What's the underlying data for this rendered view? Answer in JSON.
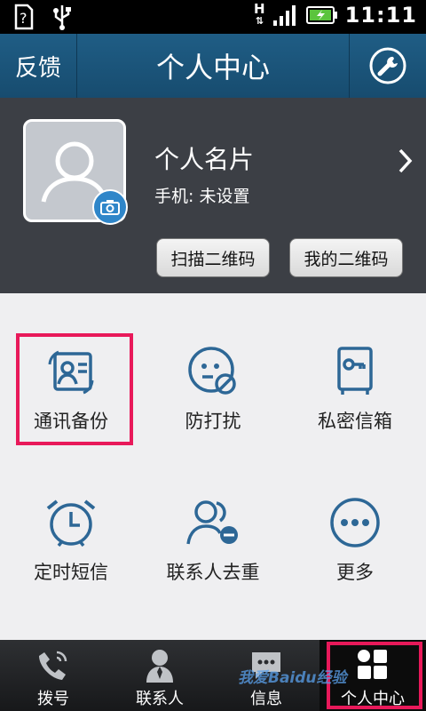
{
  "status_bar": {
    "time": "11:11",
    "network_label": "H"
  },
  "header": {
    "feedback_label": "反馈",
    "title": "个人中心",
    "settings_icon": "wrench-icon"
  },
  "profile": {
    "name": "个人名片",
    "phone": "手机: 未设置",
    "scan_qr_label": "扫描二维码",
    "my_qr_label": "我的二维码"
  },
  "features": [
    {
      "label": "通讯备份",
      "icon": "contact-backup-icon"
    },
    {
      "label": "防打扰",
      "icon": "do-not-disturb-icon"
    },
    {
      "label": "私密信箱",
      "icon": "private-safe-icon"
    },
    {
      "label": "定时短信",
      "icon": "alarm-clock-icon"
    },
    {
      "label": "联系人去重",
      "icon": "dedupe-contacts-icon"
    },
    {
      "label": "更多",
      "icon": "more-icon"
    }
  ],
  "bottom_nav": [
    {
      "label": "拨号",
      "icon": "phone-icon"
    },
    {
      "label": "联系人",
      "icon": "contact-icon"
    },
    {
      "label": "信息",
      "icon": "message-icon"
    },
    {
      "label": "个人中心",
      "icon": "grid-icon",
      "active": true
    }
  ],
  "watermark": "我爱Baidu经验",
  "colors": {
    "accent": "#1f5d85",
    "icon_blue": "#2d6796",
    "highlight": "#e8195a"
  }
}
